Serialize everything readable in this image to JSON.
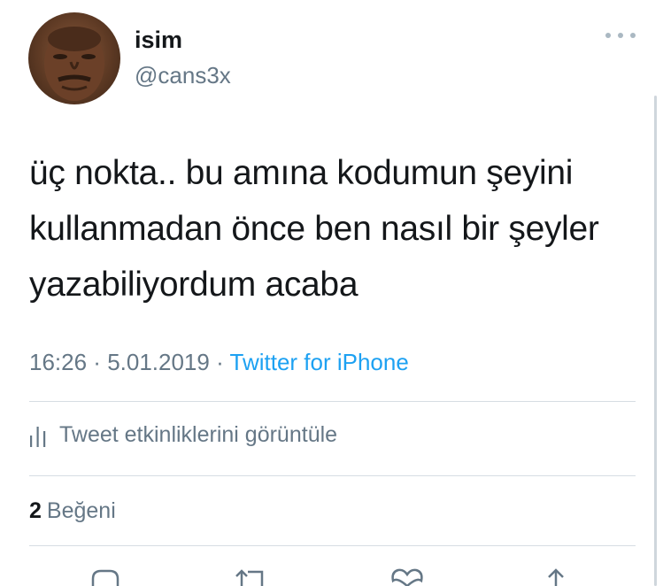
{
  "user": {
    "display_name": "isim",
    "handle": "@cans3x"
  },
  "tweet": {
    "text": "üç nokta.. bu amına kodumun şeyini\nkullanmadan önce ben nasıl bir şeyler\nyazabiliyordum acaba",
    "time": "16:26",
    "separator": " · ",
    "date": "5.01.2019",
    "source": "Twitter for iPhone"
  },
  "analytics": {
    "label": "Tweet etkinliklerini görüntüle"
  },
  "likes": {
    "count": "2",
    "label": "Beğeni"
  },
  "icons": {
    "more": "more-dots-icon",
    "analytics": "bar-chart-icon",
    "reply": "reply-icon",
    "retweet": "retweet-icon",
    "like": "heart-icon",
    "share": "share-icon"
  },
  "colors": {
    "link": "#1da1f2",
    "secondary_text": "#657786",
    "primary_text": "#14171a",
    "divider": "#d6dde3"
  }
}
